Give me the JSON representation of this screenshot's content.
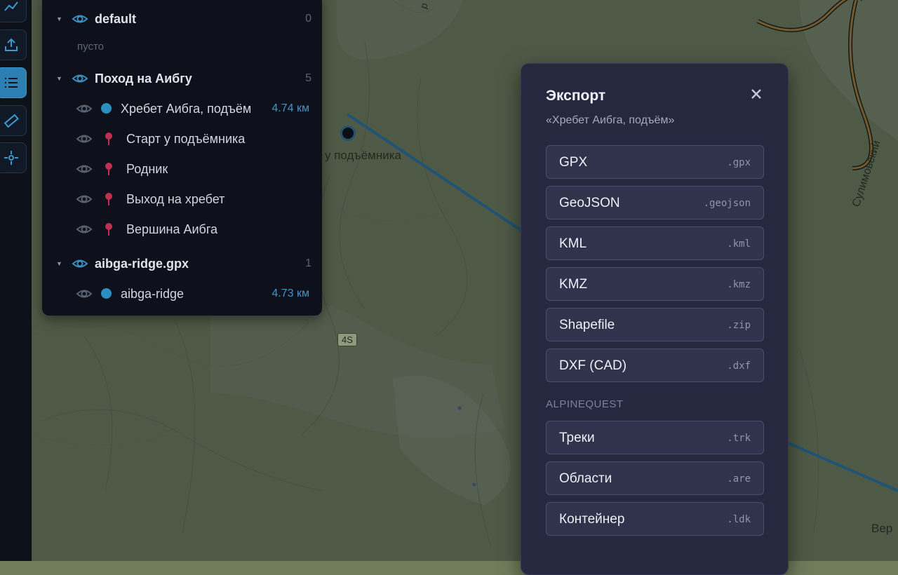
{
  "map": {
    "labels": {
      "poi": "у подъёмника",
      "road_badge": "4S",
      "street": "Сулимовский",
      "place_cut": "Вер",
      "top_cut": "р"
    }
  },
  "toolbar": {
    "buttons": [
      {
        "icon": "chart-line-icon",
        "active": false
      },
      {
        "icon": "upload-icon",
        "active": false
      },
      {
        "icon": "list-icon",
        "active": true
      },
      {
        "icon": "ruler-icon",
        "active": false
      },
      {
        "icon": "crosshair-icon",
        "active": false
      }
    ]
  },
  "layers": {
    "groups": [
      {
        "name": "default",
        "count": "0",
        "empty": "пусто",
        "items": []
      },
      {
        "name": "Поход на Аибгу",
        "count": "5",
        "items": [
          {
            "name": "Хребет Аибга, подъём",
            "kind": "track",
            "length": "4.74 км"
          },
          {
            "name": "Старт у подъёмника",
            "kind": "pin"
          },
          {
            "name": "Родник",
            "kind": "pin"
          },
          {
            "name": "Выход на хребет",
            "kind": "pin"
          },
          {
            "name": "Вершина Аибга",
            "kind": "pin"
          }
        ]
      },
      {
        "name": "aibga-ridge.gpx",
        "count": "1",
        "items": [
          {
            "name": "aibga-ridge",
            "kind": "track",
            "length": "4.73 км"
          }
        ]
      }
    ]
  },
  "dialog": {
    "title": "Экспорт",
    "subtitle": "«Хребет Аибга, подъём»",
    "formats": [
      {
        "name": "GPX",
        "ext": ".gpx"
      },
      {
        "name": "GeoJSON",
        "ext": ".geojson"
      },
      {
        "name": "KML",
        "ext": ".kml"
      },
      {
        "name": "KMZ",
        "ext": ".kmz"
      },
      {
        "name": "Shapefile",
        "ext": ".zip"
      },
      {
        "name": "DXF (CAD)",
        "ext": ".dxf"
      }
    ],
    "section_label": "ALPINEQUEST",
    "alpine_formats": [
      {
        "name": "Треки",
        "ext": ".trk"
      },
      {
        "name": "Области",
        "ext": ".are"
      },
      {
        "name": "Контейнер",
        "ext": ".ldk"
      }
    ]
  },
  "colors": {
    "accent": "#2b7fb3",
    "track": "#2d8ec0",
    "pin": "#c0304f",
    "dialog_bg": "#262840",
    "panel_bg": "#0e111b"
  }
}
